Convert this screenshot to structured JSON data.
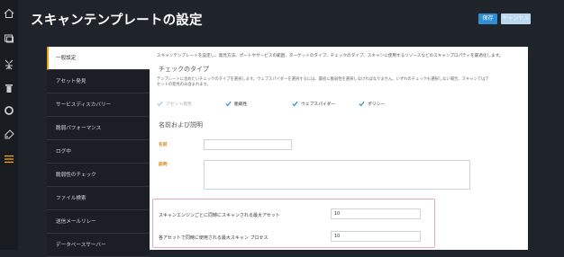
{
  "app": {
    "title": "スキャンテンプレートの設定",
    "save_label": "保存",
    "cancel_label": "キャンセル"
  },
  "rail_icons": [
    "home-icon",
    "layers-icon",
    "scan-icon",
    "trash-icon",
    "circle-icon",
    "tag-icon",
    "list-icon"
  ],
  "sidebar": {
    "items": [
      {
        "label": "一般設定",
        "active": true
      },
      {
        "label": "アセット発見",
        "active": false
      },
      {
        "label": "サービスディスカバリー",
        "active": false
      },
      {
        "label": "脆弱パフォーマンス",
        "active": false
      },
      {
        "label": "ログ中",
        "active": false
      },
      {
        "label": "脆弱性のチェック",
        "active": false
      },
      {
        "label": "ファイル検索",
        "active": false
      },
      {
        "label": "送信メールリレー",
        "active": false
      },
      {
        "label": "データベースサーバー",
        "active": false
      }
    ]
  },
  "main": {
    "description": "スキャンテンプレートを設定し、発見方法、ポートやサービスの範囲、ターゲットのタイプ、チェックのタイプ、スキャンに使用するリソースなどのスキャンプロパティを最適化します。",
    "check_type_heading": "チェックのタイプ",
    "check_type_help_1": "テンプレートに含めたいチェックのタイプを選択します。ウェブスパイダーを選択するには、最初に脆弱性を選択しなければなりません。いずれのチェックも選択しない場合、スキャンではア",
    "check_type_help_2": "セットの発見のみ含まれます。",
    "checkboxes": [
      {
        "label": "アセット発見",
        "checked": true,
        "disabled": true
      },
      {
        "label": "脆弱性",
        "checked": true,
        "disabled": false
      },
      {
        "label": "ウェブスパイダー",
        "checked": true,
        "disabled": false
      },
      {
        "label": "ポリシー",
        "checked": true,
        "disabled": false
      }
    ],
    "name_heading": "名前および説明",
    "name_label": "名前",
    "name_value": "",
    "description_label": "説明",
    "description_value": "",
    "max_assets_label": "スキャンエンジンごとに同時にスキャンされる最大アセット",
    "max_assets_value": "10",
    "max_processes_label": "各アセットで同時に使用される最大スキャン プロセス",
    "max_processes_value": "10"
  },
  "colors": {
    "accent": "#2f8fd5",
    "orange": "#f0a020",
    "sidebar_bg": "#1b1f25",
    "highlight": "#e2a8b6"
  }
}
